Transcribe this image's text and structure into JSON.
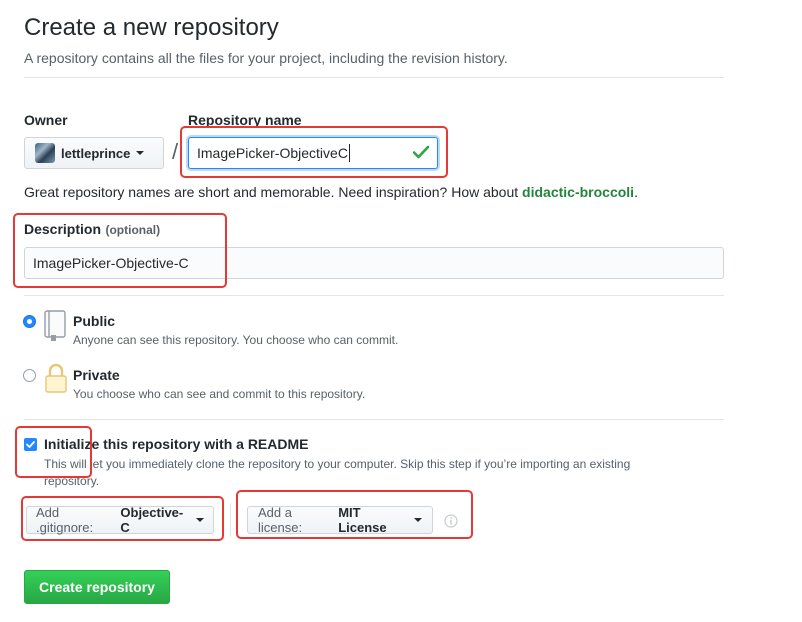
{
  "page": {
    "title": "Create a new repository",
    "subtitle": "A repository contains all the files for your project, including the revision history."
  },
  "owner": {
    "label": "Owner",
    "value": "lettleprince"
  },
  "repo": {
    "label": "Repository name",
    "separator": "/",
    "value": "ImagePicker-ObjectiveC",
    "valid_icon": "check-icon"
  },
  "name_hint": {
    "text": "Great repository names are short and memorable. Need inspiration? How about ",
    "suggestion": "didactic-broccoli",
    "suffix": "."
  },
  "description": {
    "label": "Description",
    "optional": "(optional)",
    "value": "ImagePicker-Objective-C"
  },
  "visibility": {
    "public": {
      "label": "Public",
      "desc": "Anyone can see this repository. You choose who can commit.",
      "icon": "repo-book-icon",
      "selected": true
    },
    "private": {
      "label": "Private",
      "desc": "You choose who can see and commit to this repository.",
      "icon": "lock-icon",
      "selected": false
    }
  },
  "readme": {
    "label": "Initialize this repository with a README",
    "desc_line1": "This will let you immediately clone the repository to your computer. Skip this step if you’re importing an existing",
    "desc_line2": "repository.",
    "checked": true
  },
  "gitignore": {
    "prefix": "Add .gitignore:",
    "value": "Objective-C"
  },
  "license": {
    "prefix": "Add a license:",
    "value": "MIT License",
    "info_icon": "info-icon"
  },
  "submit": {
    "label": "Create repository"
  },
  "colors": {
    "accent_blue": "#2188ff",
    "success_green": "#28a745",
    "annotation_red": "#e53935",
    "suggestion_green": "#22863a"
  }
}
